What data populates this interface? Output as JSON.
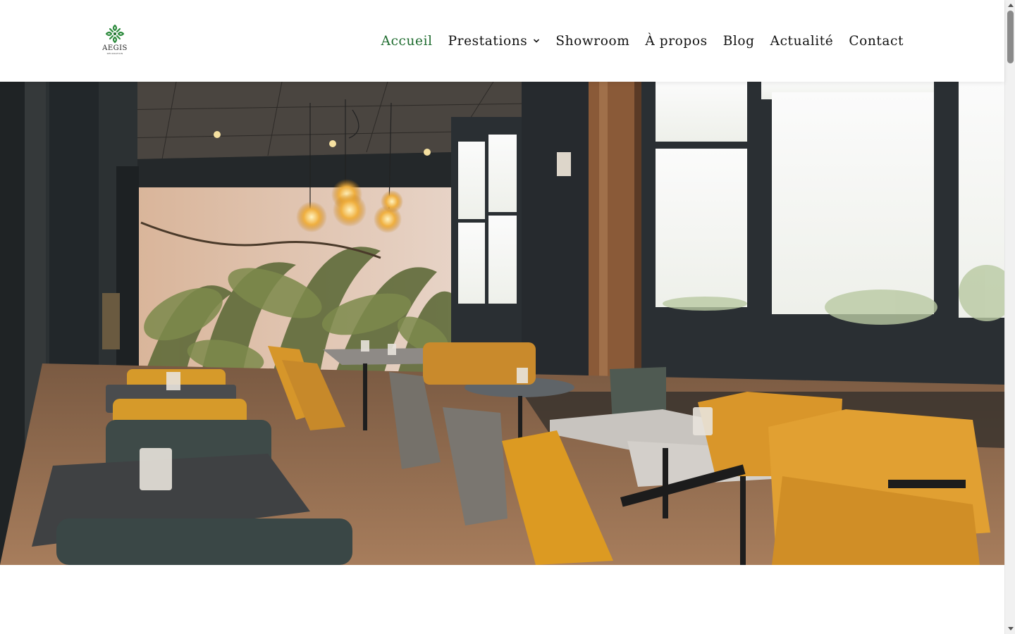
{
  "brand": {
    "name": "AEGIS",
    "tagline": "DÉCORATION",
    "accent_color": "#1e6b2e"
  },
  "nav": {
    "items": [
      {
        "label": "Accueil",
        "active": true
      },
      {
        "label": "Prestations",
        "has_dropdown": true
      },
      {
        "label": "Showroom"
      },
      {
        "label": "À propos"
      },
      {
        "label": "Blog"
      },
      {
        "label": "Actualité"
      },
      {
        "label": "Contact"
      }
    ],
    "dropdown_icon": "chevron-down-icon"
  },
  "hero": {
    "image_subject": "restaurant-interior-photo"
  },
  "colors": {
    "text": "#111111",
    "active": "#1e6b2e",
    "background": "#ffffff"
  }
}
